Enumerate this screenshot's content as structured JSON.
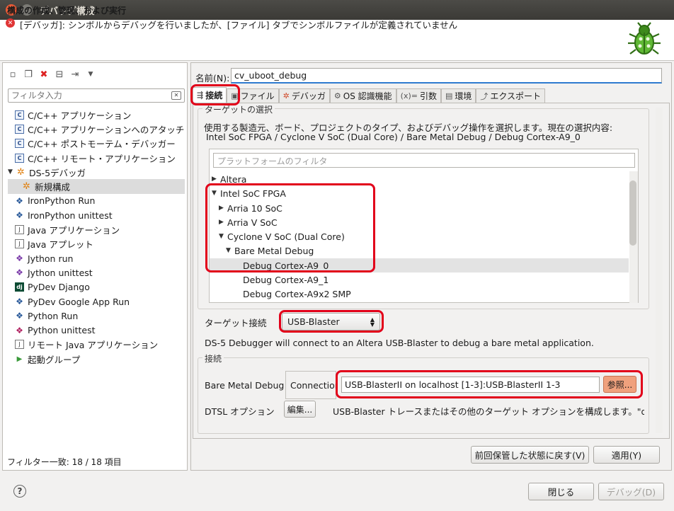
{
  "window": {
    "title": "デバッグ構成"
  },
  "header": {
    "title": "構成の作成、管理、および実行",
    "message": "[デバッガ]: シンボルからデバッグを行いましたが、[ファイル] タブでシンボルファイルが定義されていません"
  },
  "left": {
    "filter_placeholder": "フィルタ入力",
    "items": [
      {
        "label": "C/C++ アプリケーション",
        "icon": "c-app-icon"
      },
      {
        "label": "C/C++ アプリケーションへのアタッチ",
        "icon": "c-attach-icon"
      },
      {
        "label": "C/C++ ポストモーテム・デバッガー",
        "icon": "c-postmortem-icon"
      },
      {
        "label": "C/C++ リモート・アプリケーション",
        "icon": "c-remote-icon"
      },
      {
        "label": "DS-5デバッガ",
        "icon": "ds5-icon"
      },
      {
        "label": "新規構成",
        "icon": "ds5-config-icon"
      },
      {
        "label": "IronPython Run",
        "icon": "python-icon"
      },
      {
        "label": "IronPython unittest",
        "icon": "python-unittest-icon"
      },
      {
        "label": "Java アプリケーション",
        "icon": "java-app-icon"
      },
      {
        "label": "Java アプレット",
        "icon": "java-applet-icon"
      },
      {
        "label": "Jython run",
        "icon": "jython-icon"
      },
      {
        "label": "Jython unittest",
        "icon": "jython-unittest-icon"
      },
      {
        "label": "PyDev Django",
        "icon": "django-icon"
      },
      {
        "label": "PyDev Google App Run",
        "icon": "google-app-icon"
      },
      {
        "label": "Python Run",
        "icon": "python-run-icon"
      },
      {
        "label": "Python unittest",
        "icon": "python-unittest-icon"
      },
      {
        "label": "リモート Java アプリケーション",
        "icon": "remote-java-icon"
      },
      {
        "label": "起動グループ",
        "icon": "launch-group-icon"
      }
    ],
    "filter_status": "フィルター一致: 18 / 18 項目"
  },
  "config": {
    "name_label": "名前(N):",
    "name_value": "cv_uboot_debug",
    "tabs": [
      "接続",
      "ファイル",
      "デバッガ",
      "OS 認識機能",
      "引数",
      "環境",
      "エクスポート"
    ],
    "target_section": "ターゲットの選択",
    "target_desc": "使用する製造元、ボード、プロジェクトのタイプ、およびデバッグ操作を選択します。現在の選択内容:",
    "target_path": "Intel SoC FPGA / Cyclone V SoC (Dual Core) / Bare Metal Debug / Debug Cortex-A9_0",
    "platform_filter_placeholder": "プラットフォームのフィルタ",
    "tree": [
      "Altera",
      "Intel SoC FPGA",
      "Arria 10 SoC",
      "Arria V SoC",
      "Cyclone V SoC (Dual Core)",
      "Bare Metal Debug",
      "Debug Cortex-A9_0",
      "Debug Cortex-A9_1",
      "Debug Cortex-A9x2 SMP"
    ],
    "target_conn_label": "ターゲット接続",
    "target_conn_value": "USB-Blaster",
    "target_conn_desc": "DS-5 Debugger will connect to an Altera USB-Blaster to debug a bare metal application.",
    "conn_section": "接続",
    "bm_label": "Bare Metal Debug",
    "conn_label": "Connection",
    "conn_value": "USB-BlasterII on localhost [1-3]:USB-BlasterII 1-3",
    "browse": "参照...",
    "dtsl_label": "DTSL オプション",
    "edit": "編集...",
    "dtsl_desc": "USB-Blaster トレースまたはその他のターゲット オプションを構成します。\"defau"
  },
  "buttons": {
    "revert": "前回保管した状態に戻す(V)",
    "apply": "適用(Y)",
    "close": "閉じる",
    "debug": "デバッグ(D)"
  },
  "colors": {
    "highlight": "#e2001a",
    "browse": "#f0a17d",
    "accent": "#2e7bcf"
  }
}
